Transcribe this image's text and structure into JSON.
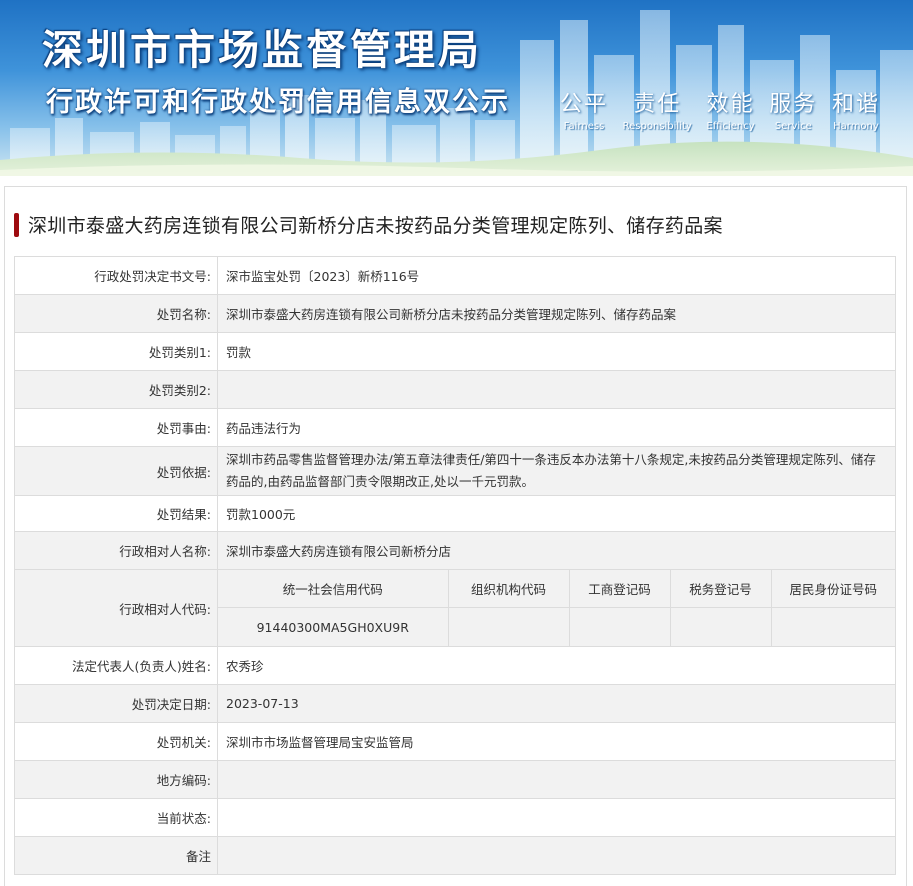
{
  "banner": {
    "title": "深圳市市场监督管理局",
    "subtitle": "行政许可和行政处罚信用信息双公示",
    "slogans": [
      {
        "zh": "公平",
        "en": "Fairness"
      },
      {
        "zh": "责任",
        "en": "Responsibility"
      },
      {
        "zh": "效能",
        "en": "Efficiency"
      },
      {
        "zh": "服务",
        "en": "Service"
      },
      {
        "zh": "和谐",
        "en": "Harmony"
      }
    ]
  },
  "case_title": "深圳市泰盛大药房连锁有限公司新桥分店未按药品分类管理规定陈列、储存药品案",
  "rows": {
    "decision_no": {
      "label": "行政处罚决定书文号:",
      "value": "深市监宝处罚〔2023〕新桥116号"
    },
    "penalty_name": {
      "label": "处罚名称:",
      "value": "深圳市泰盛大药房连锁有限公司新桥分店未按药品分类管理规定陈列、储存药品案"
    },
    "category1": {
      "label": "处罚类别1:",
      "value": "罚款"
    },
    "category2": {
      "label": "处罚类别2:",
      "value": ""
    },
    "reason": {
      "label": "处罚事由:",
      "value": "药品违法行为"
    },
    "basis": {
      "label": "处罚依据:",
      "value": "深圳市药品零售监督管理办法/第五章法律责任/第四十一条违反本办法第十八条规定,未按药品分类管理规定陈列、储存药品的,由药品监督部门责令限期改正,处以一千元罚款。"
    },
    "result": {
      "label": "处罚结果:",
      "value": "罚款1000元"
    },
    "counterparty_name": {
      "label": "行政相对人名称:",
      "value": "深圳市泰盛大药房连锁有限公司新桥分店"
    },
    "counterparty_code": {
      "label": "行政相对人代码:",
      "headers": [
        "统一社会信用代码",
        "组织机构代码",
        "工商登记码",
        "税务登记号",
        "居民身份证号码"
      ],
      "values": [
        "91440300MA5GH0XU9R",
        "",
        "",
        "",
        ""
      ]
    },
    "legal_rep": {
      "label": "法定代表人(负责人)姓名:",
      "value": "农秀珍"
    },
    "decision_date": {
      "label": "处罚决定日期:",
      "value": "2023-07-13"
    },
    "authority": {
      "label": "处罚机关:",
      "value": "深圳市市场监督管理局宝安监管局"
    },
    "region_code": {
      "label": "地方编码:",
      "value": ""
    },
    "status": {
      "label": "当前状态:",
      "value": ""
    },
    "remark": {
      "label": "备注",
      "value": ""
    }
  },
  "colors": {
    "accent_bar": "#9e0b0f",
    "alt_row_bg": "#f2f2f2",
    "border": "#dcdcdc",
    "banner_top": "#1f72c4"
  }
}
